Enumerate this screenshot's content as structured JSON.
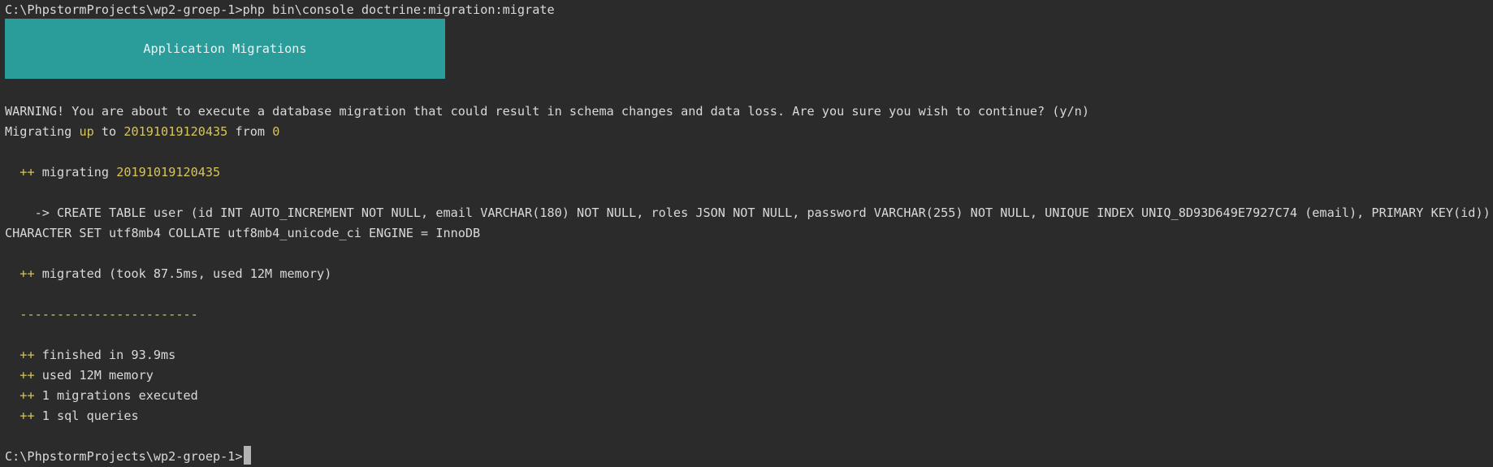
{
  "terminal": {
    "command_line": "C:\\PhpstormProjects\\wp2-groep-1>php bin\\console doctrine:migration:migrate",
    "banner_title": "Application Migrations",
    "warning": "WARNING! You are about to execute a database migration that could result in schema changes and data loss. Are you sure you wish to continue? (y/n)",
    "migrating": {
      "prefix": "Migrating ",
      "direction": "up",
      "to_text": " to ",
      "version": "20191019120435",
      "from_text": " from ",
      "from_version": "0"
    },
    "migrating_step": {
      "marker": "++",
      "label": " migrating ",
      "version": "20191019120435"
    },
    "sql_line_1": "    -> CREATE TABLE user (id INT AUTO_INCREMENT NOT NULL, email VARCHAR(180) NOT NULL, roles JSON NOT NULL, password VARCHAR(255) NOT NULL, UNIQUE INDEX UNIQ_8D93D649E7927C74 (email), PRIMARY KEY(id)) DEFAULT",
    "sql_line_2": "CHARACTER SET utf8mb4 COLLATE utf8mb4_unicode_ci ENGINE = InnoDB",
    "migrated": {
      "marker": "++",
      "text": " migrated (took 87.5ms, used 12M memory)"
    },
    "separator": "------------------------",
    "summary": [
      {
        "marker": "++",
        "text": " finished in 93.9ms"
      },
      {
        "marker": "++",
        "text": " used 12M memory"
      },
      {
        "marker": "++",
        "text": " 1 migrations executed"
      },
      {
        "marker": "++",
        "text": " 1 sql queries"
      }
    ],
    "prompt": "C:\\PhpstormProjects\\wp2-groep-1>"
  },
  "colors": {
    "background": "#2b2b2b",
    "foreground": "#d9d9d9",
    "highlight": "#d7c45c",
    "banner": "#2a9d9b"
  }
}
